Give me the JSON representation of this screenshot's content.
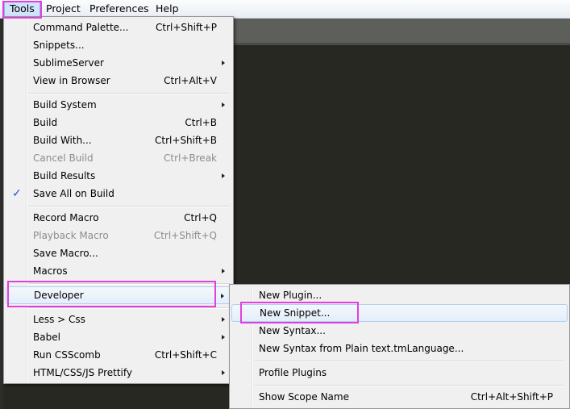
{
  "menubar": {
    "items": [
      "Tools",
      "Project",
      "Preferences",
      "Help"
    ]
  },
  "tools_menu": {
    "items": [
      {
        "label": "Command Palette...",
        "shortcut": "Ctrl+Shift+P"
      },
      {
        "label": "Snippets...",
        "shortcut": ""
      },
      {
        "label": "SublimeServer",
        "shortcut": ""
      },
      {
        "label": "View in Browser",
        "shortcut": "Ctrl+Alt+V"
      },
      {
        "label": "Build System",
        "shortcut": ""
      },
      {
        "label": "Build",
        "shortcut": "Ctrl+B"
      },
      {
        "label": "Build With...",
        "shortcut": "Ctrl+Shift+B"
      },
      {
        "label": "Cancel Build",
        "shortcut": "Ctrl+Break"
      },
      {
        "label": "Build Results",
        "shortcut": ""
      },
      {
        "label": "Save All on Build",
        "shortcut": ""
      },
      {
        "label": "Record Macro",
        "shortcut": "Ctrl+Q"
      },
      {
        "label": "Playback Macro",
        "shortcut": "Ctrl+Shift+Q"
      },
      {
        "label": "Save Macro...",
        "shortcut": ""
      },
      {
        "label": "Macros",
        "shortcut": ""
      },
      {
        "label": "Developer",
        "shortcut": ""
      },
      {
        "label": "Less > Css",
        "shortcut": ""
      },
      {
        "label": "Babel",
        "shortcut": ""
      },
      {
        "label": "Run CSScomb",
        "shortcut": "Ctrl+Shift+C"
      },
      {
        "label": "HTML/CSS/JS Prettify",
        "shortcut": ""
      }
    ]
  },
  "developer_menu": {
    "items": [
      {
        "label": "New Plugin...",
        "shortcut": ""
      },
      {
        "label": "New Snippet...",
        "shortcut": ""
      },
      {
        "label": "New Syntax...",
        "shortcut": ""
      },
      {
        "label": "New Syntax from Plain text.tmLanguage...",
        "shortcut": ""
      },
      {
        "label": "Profile Plugins",
        "shortcut": ""
      },
      {
        "label": "Show Scope Name",
        "shortcut": "Ctrl+Alt+Shift+P"
      }
    ]
  },
  "icons": {
    "check": "checkmark-icon",
    "submenu": "submenu-arrow-icon"
  },
  "colors": {
    "highlight": "#e23fe0",
    "check": "#1c55c7",
    "editor_bg": "#272822"
  }
}
